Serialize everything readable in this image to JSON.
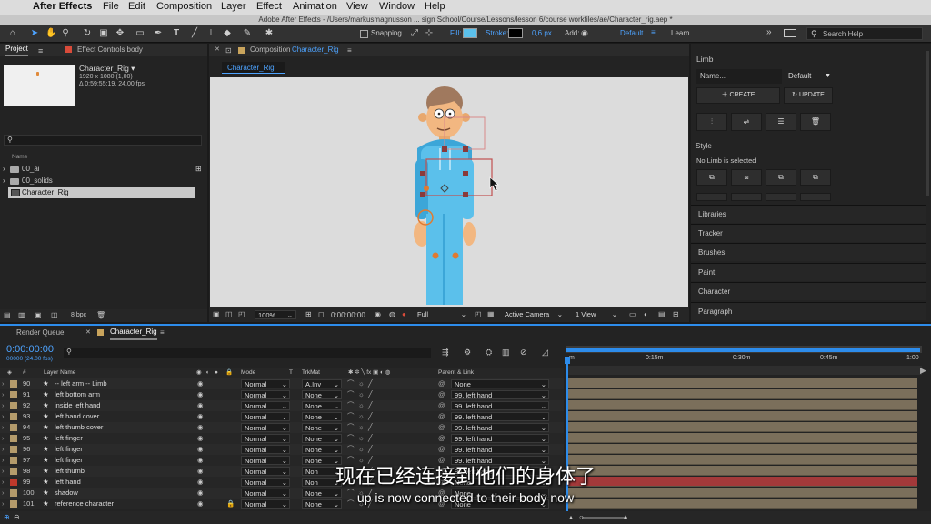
{
  "menubar": {
    "app_name": "After Effects",
    "items": [
      "File",
      "Edit",
      "Composition",
      "Layer",
      "Effect",
      "Animation",
      "View",
      "Window",
      "Help"
    ]
  },
  "titlebar": {
    "title": "Adobe After Effects - /Users/markusmagnusson ... sign School/Course/Lessons/lesson 6/course workfiles/ae/Character_rig.aep *"
  },
  "toolbar": {
    "snapping": "Snapping",
    "fill": "Fill:",
    "stroke": "Stroke:",
    "stroke_width": "0,6 px",
    "add": "Add:",
    "workspace_default": "Default",
    "workspace_learn": "Learn",
    "search_placeholder": "Search Help"
  },
  "project": {
    "tab_project": "Project",
    "tab_effect": "Effect Controls body",
    "comp_name": "Character_Rig ▾",
    "comp_info1": "1920 x 1080 (1,00)",
    "comp_info2": "Δ 0;59;55;19, 24,00 fps",
    "col_name": "Name",
    "items": [
      {
        "name": "00_ai",
        "type": "folder"
      },
      {
        "name": "00_solids",
        "type": "folder"
      },
      {
        "name": "Character_Rig",
        "type": "comp"
      }
    ],
    "bpc": "8 bpc"
  },
  "composition": {
    "tab_label": "Composition",
    "tab_comp": "Character_Rig",
    "subtab": "Character_Rig",
    "zoom": "100%",
    "timecode": "0:00:00:00",
    "resolution": "Full",
    "camera": "Active Camera",
    "views": "1 View"
  },
  "limb": {
    "title": "Limb",
    "name_placeholder": "Name...",
    "style_select": "Default",
    "create": "CREATE",
    "update": "UPDATE",
    "style_title": "Style",
    "no_limb": "No Limb is selected"
  },
  "side_panels": [
    "Libraries",
    "Tracker",
    "Brushes",
    "Paint",
    "Character",
    "Paragraph"
  ],
  "timeline": {
    "tab_render": "Render Queue",
    "tab_comp": "Character_Rig",
    "timecode": "0:00:00:00",
    "frames": "00000 (24.00 fps)",
    "col_num": "#",
    "col_layer": "Layer Name",
    "col_mode": "Mode",
    "col_t": "T",
    "col_trkmat": "TrkMat",
    "col_parent": "Parent & Link",
    "ruler": [
      "0:15m",
      "0:30m",
      "0:45m",
      "1:00"
    ],
    "ruler_start": "m",
    "layers": [
      {
        "num": "90",
        "name": "-- left arm -- Limb",
        "color": "#b49b6b",
        "mode": "Normal",
        "trkmat": "A.Inv",
        "parent": "None"
      },
      {
        "num": "91",
        "name": "left bottom arm",
        "color": "#b49b6b",
        "mode": "Normal",
        "trkmat": "None",
        "parent": "99. left hand"
      },
      {
        "num": "92",
        "name": "inside left hand",
        "color": "#b49b6b",
        "mode": "Normal",
        "trkmat": "None",
        "parent": "99. left hand"
      },
      {
        "num": "93",
        "name": "left hand cover",
        "color": "#b49b6b",
        "mode": "Normal",
        "trkmat": "None",
        "parent": "99. left hand"
      },
      {
        "num": "94",
        "name": "left thumb cover",
        "color": "#b49b6b",
        "mode": "Normal",
        "trkmat": "None",
        "parent": "99. left hand"
      },
      {
        "num": "95",
        "name": "left finger",
        "color": "#b49b6b",
        "mode": "Normal",
        "trkmat": "None",
        "parent": "99. left hand"
      },
      {
        "num": "96",
        "name": "left finger",
        "color": "#b49b6b",
        "mode": "Normal",
        "trkmat": "None",
        "parent": "99. left hand"
      },
      {
        "num": "97",
        "name": "left finger",
        "color": "#b49b6b",
        "mode": "Normal",
        "trkmat": "None",
        "parent": "99. left hand"
      },
      {
        "num": "98",
        "name": "left thumb",
        "color": "#b49b6b",
        "mode": "Normal",
        "trkmat": "Non",
        "parent": "99. left hand"
      },
      {
        "num": "99",
        "name": "left hand",
        "color": "#c0392b",
        "mode": "Normal",
        "trkmat": "Non",
        "parent": "None"
      },
      {
        "num": "100",
        "name": "shadow",
        "color": "#b49b6b",
        "mode": "Normal",
        "trkmat": "None",
        "parent": "None"
      },
      {
        "num": "101",
        "name": "reference character",
        "color": "#b49b6b",
        "mode": "Normal",
        "trkmat": "None",
        "parent": "None"
      }
    ]
  },
  "subtitles": {
    "chinese": "现在已经连接到他们的身体了",
    "english": "up is now connected to their body now"
  },
  "colors": {
    "accent": "#2d8ceb",
    "fill_swatch": "#5bc0eb",
    "track_red": "#a3393a"
  }
}
